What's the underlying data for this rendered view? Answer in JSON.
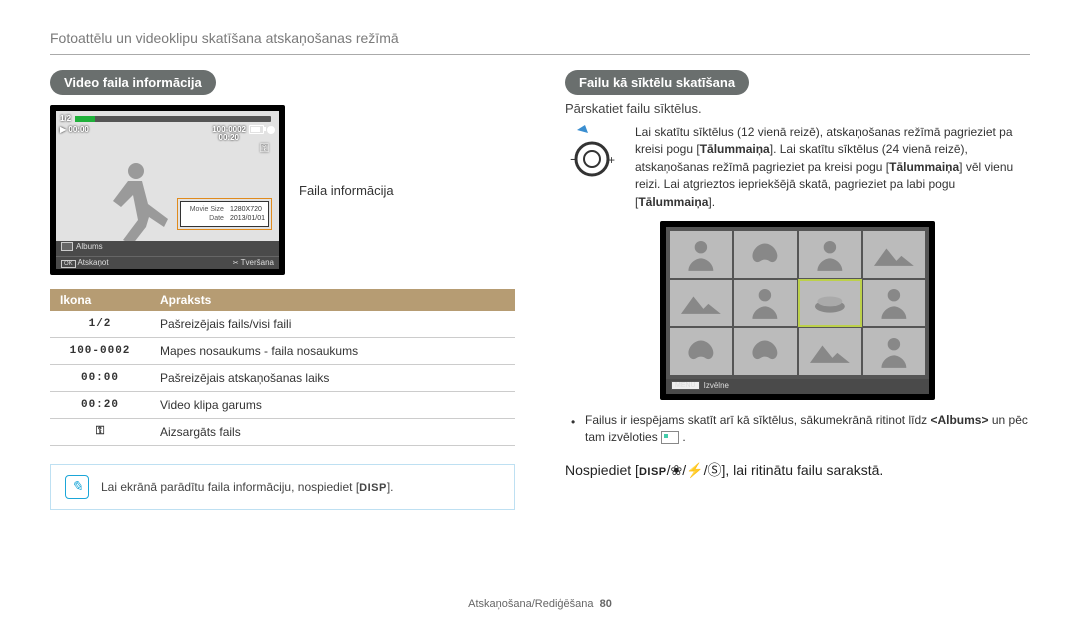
{
  "header": "Fotoattēlu un videoklipu skatīšana atskaņošanas režīmā",
  "left": {
    "title": "Video faila informācija",
    "screen": {
      "counter": "1/2",
      "file_id": "100-0002",
      "cur_time": "00:00",
      "duration": "00:20",
      "info_label_size": "Movie Size",
      "info_val_size": "1280X720",
      "info_label_date": "Date",
      "info_val_date": "2013/01/01",
      "albums": "Albums",
      "ok": "OK",
      "play": "Atskaņot",
      "capture": "Tveršana"
    },
    "pointer": "Faila informācija",
    "table": {
      "h1": "Ikona",
      "h2": "Apraksts",
      "rows": [
        {
          "icon": "1/2",
          "iconClass": "lcd-text",
          "desc": "Pašreizējais fails/visi faili"
        },
        {
          "icon": "100-0002",
          "iconClass": "lcd-text",
          "desc": "Mapes nosaukums - faila nosaukums"
        },
        {
          "icon": "00:00",
          "iconClass": "lcd-text",
          "desc": "Pašreizējais atskaņošanas laiks"
        },
        {
          "icon": "00:20",
          "iconClass": "lcd-text",
          "desc": "Video klipa garums"
        },
        {
          "icon": "⚿",
          "iconClass": "",
          "desc": "Aizsargāts fails"
        }
      ]
    },
    "note_pre": "Lai ekrānā parādītu faila informāciju, nospiediet [",
    "note_disp": "DISP",
    "note_post": "]."
  },
  "right": {
    "title": "Failu kā sīktēlu skatīšana",
    "sub": "Pārskatiet failu sīktēlus.",
    "zoom_text_1": "Lai skatītu sīktēlus (12 vienā reizē), atskaņošanas režīmā pagrieziet pa kreisi pogu [",
    "bold1": "Tālummaiņa",
    "zoom_text_2": "]. Lai skatītu sīktēlus (24 vienā reizē), atskaņošanas režīmā pagrieziet pa kreisi pogu [",
    "bold2": "Tālummaiņa",
    "zoom_text_3": "] vēl vienu reizi. Lai atgrieztos iepriekšējā skatā, pagrieziet pa labi pogu [",
    "bold3": "Tālummaiņa",
    "zoom_text_4": "].",
    "thumb_menu": "MENU",
    "thumb_menu_label": "Izvēlne",
    "bullet_pre": "Failus ir iespējams skatīt arī kā sīktēlus, sākumekrānā ritinot līdz ",
    "bullet_bold": "<Albums>",
    "bullet_post": " un pēc tam izvēloties ",
    "press_pre": "Nospiediet [",
    "press_disp": "DISP",
    "press_mid": "/",
    "press_post": "], lai ritinātu failu sarakstā."
  },
  "footer": {
    "section": "Atskaņošana/Rediģēšana",
    "page": "80"
  }
}
